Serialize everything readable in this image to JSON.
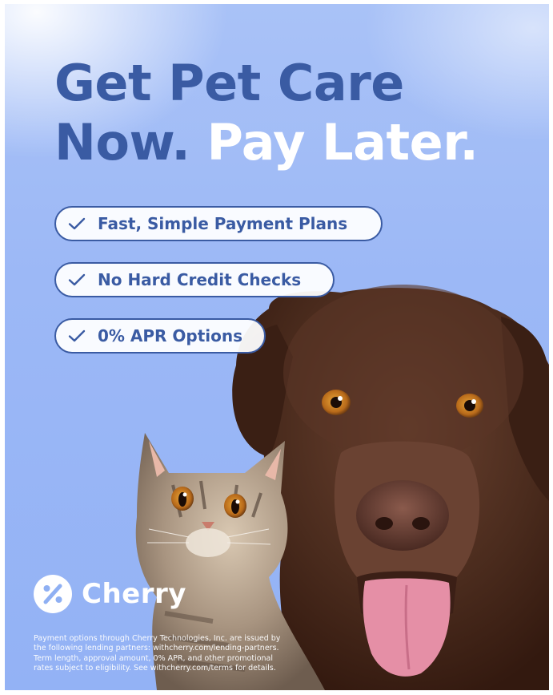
{
  "headline": {
    "line1": "Get Pet Care",
    "line2_blue": "Now.",
    "line2_white": "Pay Later."
  },
  "benefits": [
    {
      "label": "Fast, Simple Payment Plans",
      "icon": "checkmark-icon"
    },
    {
      "label": "No Hard Credit Checks",
      "icon": "checkmark-icon"
    },
    {
      "label": "0% APR Options",
      "icon": "checkmark-icon"
    }
  ],
  "brand": {
    "name": "Cherry",
    "logo_icon": "percent-badge-icon"
  },
  "disclaimer": "Payment options through Cherry Technologies, Inc. are issued by the following lending partners: withcherry.com/lending-partners. Term length, approval amount, 0% APR, and other promotional rates subject to eligibility. See withcherry.com/terms for details.",
  "colors": {
    "brand_blue": "#3a5ba3",
    "background_blue": "#9cb8f6",
    "white": "#ffffff"
  }
}
